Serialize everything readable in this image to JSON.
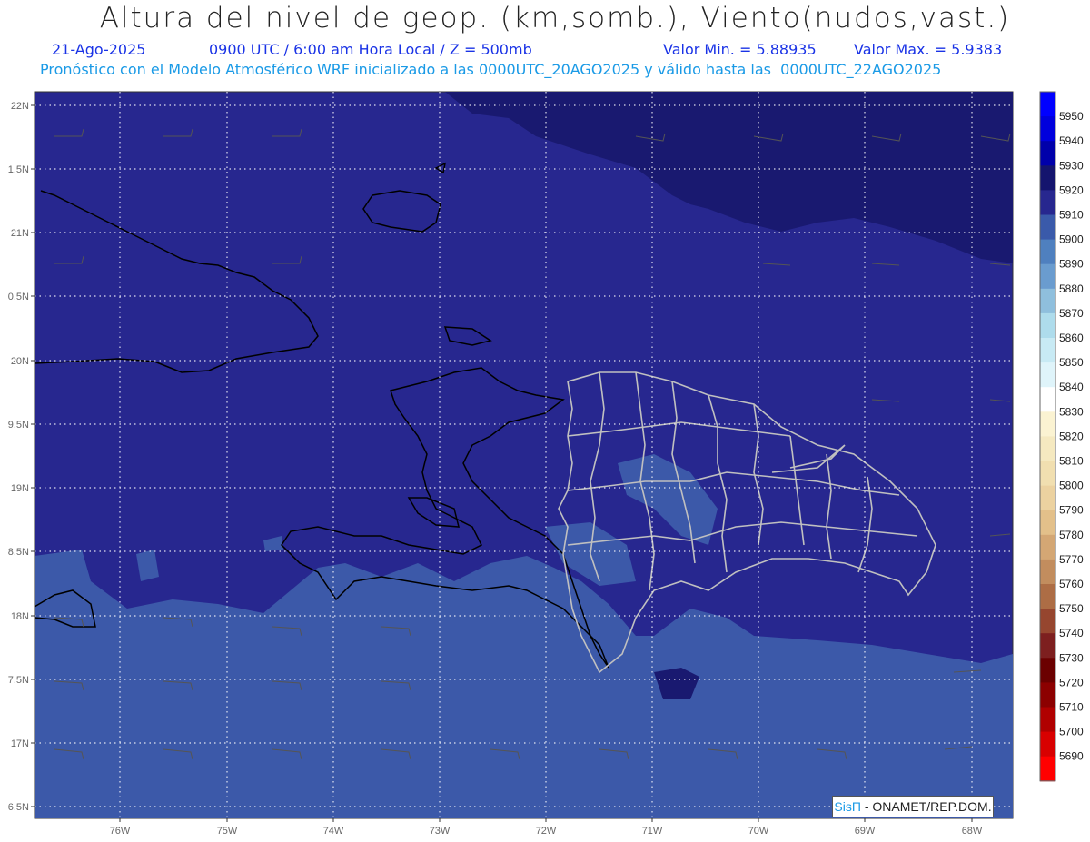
{
  "title": "Altura del nivel de geop. (km,somb.), Viento(nudos,vast.)",
  "subtitle": {
    "date": "21-Ago-2025",
    "time": "0900 UTC / 6:00 am Hora Local / Z = 500mb",
    "min": "Valor Min. = 5.88935",
    "max": "Valor Max. = 5.9383"
  },
  "forecast_line": "Pronóstico con el Modelo Atmosférico WRF inicializado a las 0000UTC_20AGO2025 y válido hasta las  0000UTC_22AGO2025",
  "lat_labels": [
    "22N",
    "1.5N",
    "21N",
    "0.5N",
    "20N",
    "9.5N",
    "19N",
    "8.5N",
    "18N",
    "7.5N",
    "17N",
    "6.5N"
  ],
  "lon_labels": [
    "76W",
    "75W",
    "74W",
    "73W",
    "72W",
    "71W",
    "70W",
    "69W",
    "68W"
  ],
  "colorbar": {
    "levels": [
      "5950",
      "5940",
      "5930",
      "5920",
      "5910",
      "5900",
      "5890",
      "5880",
      "5870",
      "5860",
      "5850",
      "5840",
      "5830",
      "5820",
      "5810",
      "5800",
      "5790",
      "5780",
      "5770",
      "5760",
      "5750",
      "5740",
      "5730",
      "5720",
      "5710",
      "5700",
      "5690"
    ],
    "colors": [
      "#0000ff",
      "#0000dd",
      "#0000aa",
      "#14146e",
      "#27278f",
      "#3a5aaa",
      "#4f80bf",
      "#6a9ccf",
      "#8fbfdd",
      "#aedcec",
      "#c8eaf4",
      "#dff4fa",
      "#ffffff",
      "#fbf3d2",
      "#f5e9c0",
      "#f1dfb0",
      "#ecd2a0",
      "#e3c08a",
      "#d4a774",
      "#c28d5e",
      "#ad6d45",
      "#96462f",
      "#7d1f1f",
      "#6b0000",
      "#8c0000",
      "#b00000",
      "#d80000",
      "#ff0000"
    ]
  },
  "credit": {
    "brand": "SisΠ",
    "text": " - ONAMET/REP.DOM."
  }
}
